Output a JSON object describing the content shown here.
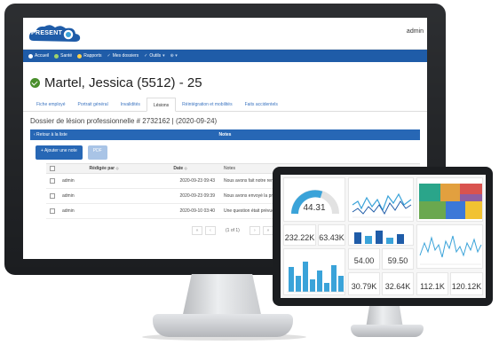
{
  "app": {
    "brand": "PRESENT",
    "user": "admin"
  },
  "nav": [
    {
      "label": "Accueil",
      "icon": "home-icon"
    },
    {
      "label": "Santé",
      "icon": "health-icon"
    },
    {
      "label": "Rapports",
      "icon": "reports-icon"
    },
    {
      "label": "Mes dossiers",
      "icon": "folder-icon"
    },
    {
      "label": "Outils",
      "icon": "tools-icon"
    }
  ],
  "employee": {
    "title": "Martel, Jessica (5512) - 25"
  },
  "tabs": [
    {
      "label": "Fiche employé",
      "active": false
    },
    {
      "label": "Portrait général",
      "active": false
    },
    {
      "label": "Invalidités",
      "active": false
    },
    {
      "label": "Lésions",
      "active": true
    },
    {
      "label": "Réintégration et mobilités",
      "active": false
    },
    {
      "label": "Faits accidentels",
      "active": false
    }
  ],
  "file": {
    "title": "Dossier de lésion professionnelle # 2732162 | (2020-09-24)"
  },
  "panel": {
    "back_label": "‹ Retour à la liste",
    "title": "Notes"
  },
  "buttons": {
    "add_note": "+ Ajouter une note",
    "pdf": "PDF"
  },
  "table": {
    "columns": [
      "Rédigée par",
      "Date",
      "Notes"
    ],
    "rows": [
      {
        "by": "admin",
        "date": "2020-09-23 09:43",
        "note": "Nous avons fait notre rencontre"
      },
      {
        "by": "admin",
        "date": "2020-09-23 09:39",
        "note": "Nous avons envoyé la proposition"
      },
      {
        "by": "admin",
        "date": "2020-09-10 03:40",
        "note": "Une question était prévue le"
      }
    ]
  },
  "pagination": {
    "info": "(1 of 1)"
  },
  "dashboard": {
    "gauge_value": "44.31",
    "kpis": [
      "232.22K",
      "63.43K",
      "54.00",
      "59.50",
      "30.79K",
      "32.64K",
      "112.1K",
      "120.12K"
    ]
  },
  "colors": {
    "brand_blue": "#1f5ca8",
    "accent_blue": "#2767b5",
    "success_green": "#4a8f2c",
    "chart_teal": "#3aa3d9"
  }
}
